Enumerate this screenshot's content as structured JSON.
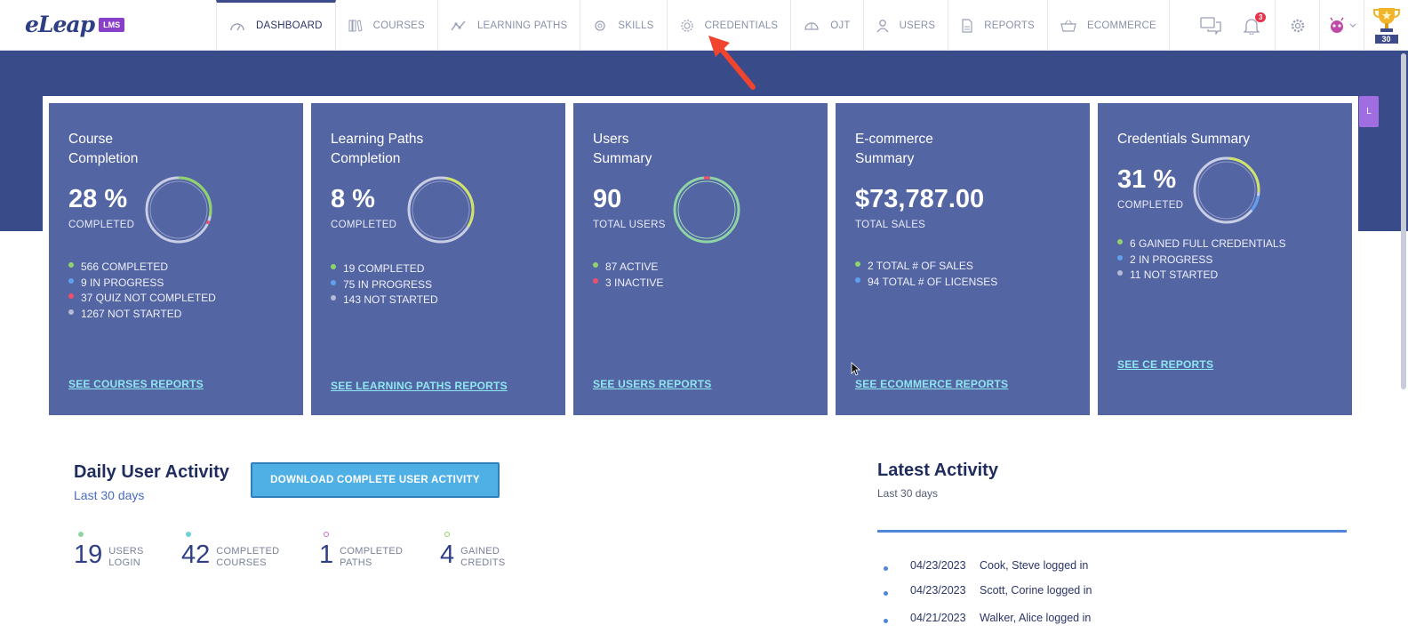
{
  "logo": {
    "text": "eLeap",
    "badge": "LMS"
  },
  "nav": [
    {
      "label": "DASHBOARD",
      "icon": "gauge-icon"
    },
    {
      "label": "COURSES",
      "icon": "books-icon"
    },
    {
      "label": "LEARNING PATHS",
      "icon": "path-icon"
    },
    {
      "label": "SKILLS",
      "icon": "skills-icon"
    },
    {
      "label": "CREDENTIALS",
      "icon": "credentials-icon"
    },
    {
      "label": "OJT",
      "icon": "ojt-icon"
    },
    {
      "label": "USERS",
      "icon": "user-icon"
    },
    {
      "label": "REPORTS",
      "icon": "report-icon"
    },
    {
      "label": "ECOMMERCE",
      "icon": "basket-icon"
    }
  ],
  "header_right": {
    "notifications_count": "3",
    "trophy_points": "30"
  },
  "side_tab": "L",
  "cards": {
    "course": {
      "title_l1": "Course",
      "title_l2": "Completion",
      "value": "28 %",
      "value_label": "COMPLETED",
      "items": [
        "566 COMPLETED",
        "9 IN PROGRESS",
        "37 QUIZ NOT COMPLETED",
        "1267 NOT STARTED"
      ],
      "link": "SEE COURSES REPORTS"
    },
    "paths": {
      "title_l1": "Learning Paths",
      "title_l2": "Completion",
      "value": "8 %",
      "value_label": "COMPLETED",
      "items": [
        "19 COMPLETED",
        "75 IN PROGRESS",
        "143 NOT STARTED"
      ],
      "link": "SEE LEARNING PATHS REPORTS"
    },
    "users": {
      "title_l1": "Users",
      "title_l2": "Summary",
      "value": "90",
      "value_label": "TOTAL USERS",
      "items": [
        "87 ACTIVE",
        "3 INACTIVE"
      ],
      "link": "SEE USERS REPORTS"
    },
    "ecommerce": {
      "title_l1": "E-commerce",
      "title_l2": "Summary",
      "value": "$73,787.00",
      "value_label": "TOTAL SALES",
      "items": [
        "2 TOTAL # OF SALES",
        "94 TOTAL # OF LICENSES"
      ],
      "link": "SEE ECOMMERCE REPORTS"
    },
    "credentials": {
      "title": "Credentials Summary",
      "value": "31 %",
      "value_label": "COMPLETED",
      "items": [
        "6 GAINED FULL CREDENTIALS",
        "2 IN PROGRESS",
        "11 NOT STARTED"
      ],
      "link": "SEE CE REPORTS"
    }
  },
  "colors": {
    "green": "#8ed46a",
    "blue": "#5fa0f0",
    "red": "#f0506a",
    "gray": "#b5bbd4"
  },
  "daily": {
    "title": "Daily User Activity",
    "subtitle": "Last 30 days",
    "download_button": "DOWNLOAD COMPLETE USER ACTIVITY",
    "stats": [
      {
        "num": "19",
        "l1": "USERS",
        "l2": "LOGIN"
      },
      {
        "num": "42",
        "l1": "COMPLETED",
        "l2": "COURSES"
      },
      {
        "num": "1",
        "l1": "COMPLETED",
        "l2": "PATHS"
      },
      {
        "num": "4",
        "l1": "GAINED",
        "l2": "CREDITS"
      }
    ]
  },
  "latest": {
    "title": "Latest Activity",
    "subtitle": "Last 30 days",
    "rows": [
      {
        "date": "04/23/2023",
        "text": "Cook, Steve logged in"
      },
      {
        "date": "04/23/2023",
        "text": "Scott, Corine logged in"
      },
      {
        "date": "04/21/2023",
        "text": "Walker, Alice logged in"
      }
    ]
  }
}
